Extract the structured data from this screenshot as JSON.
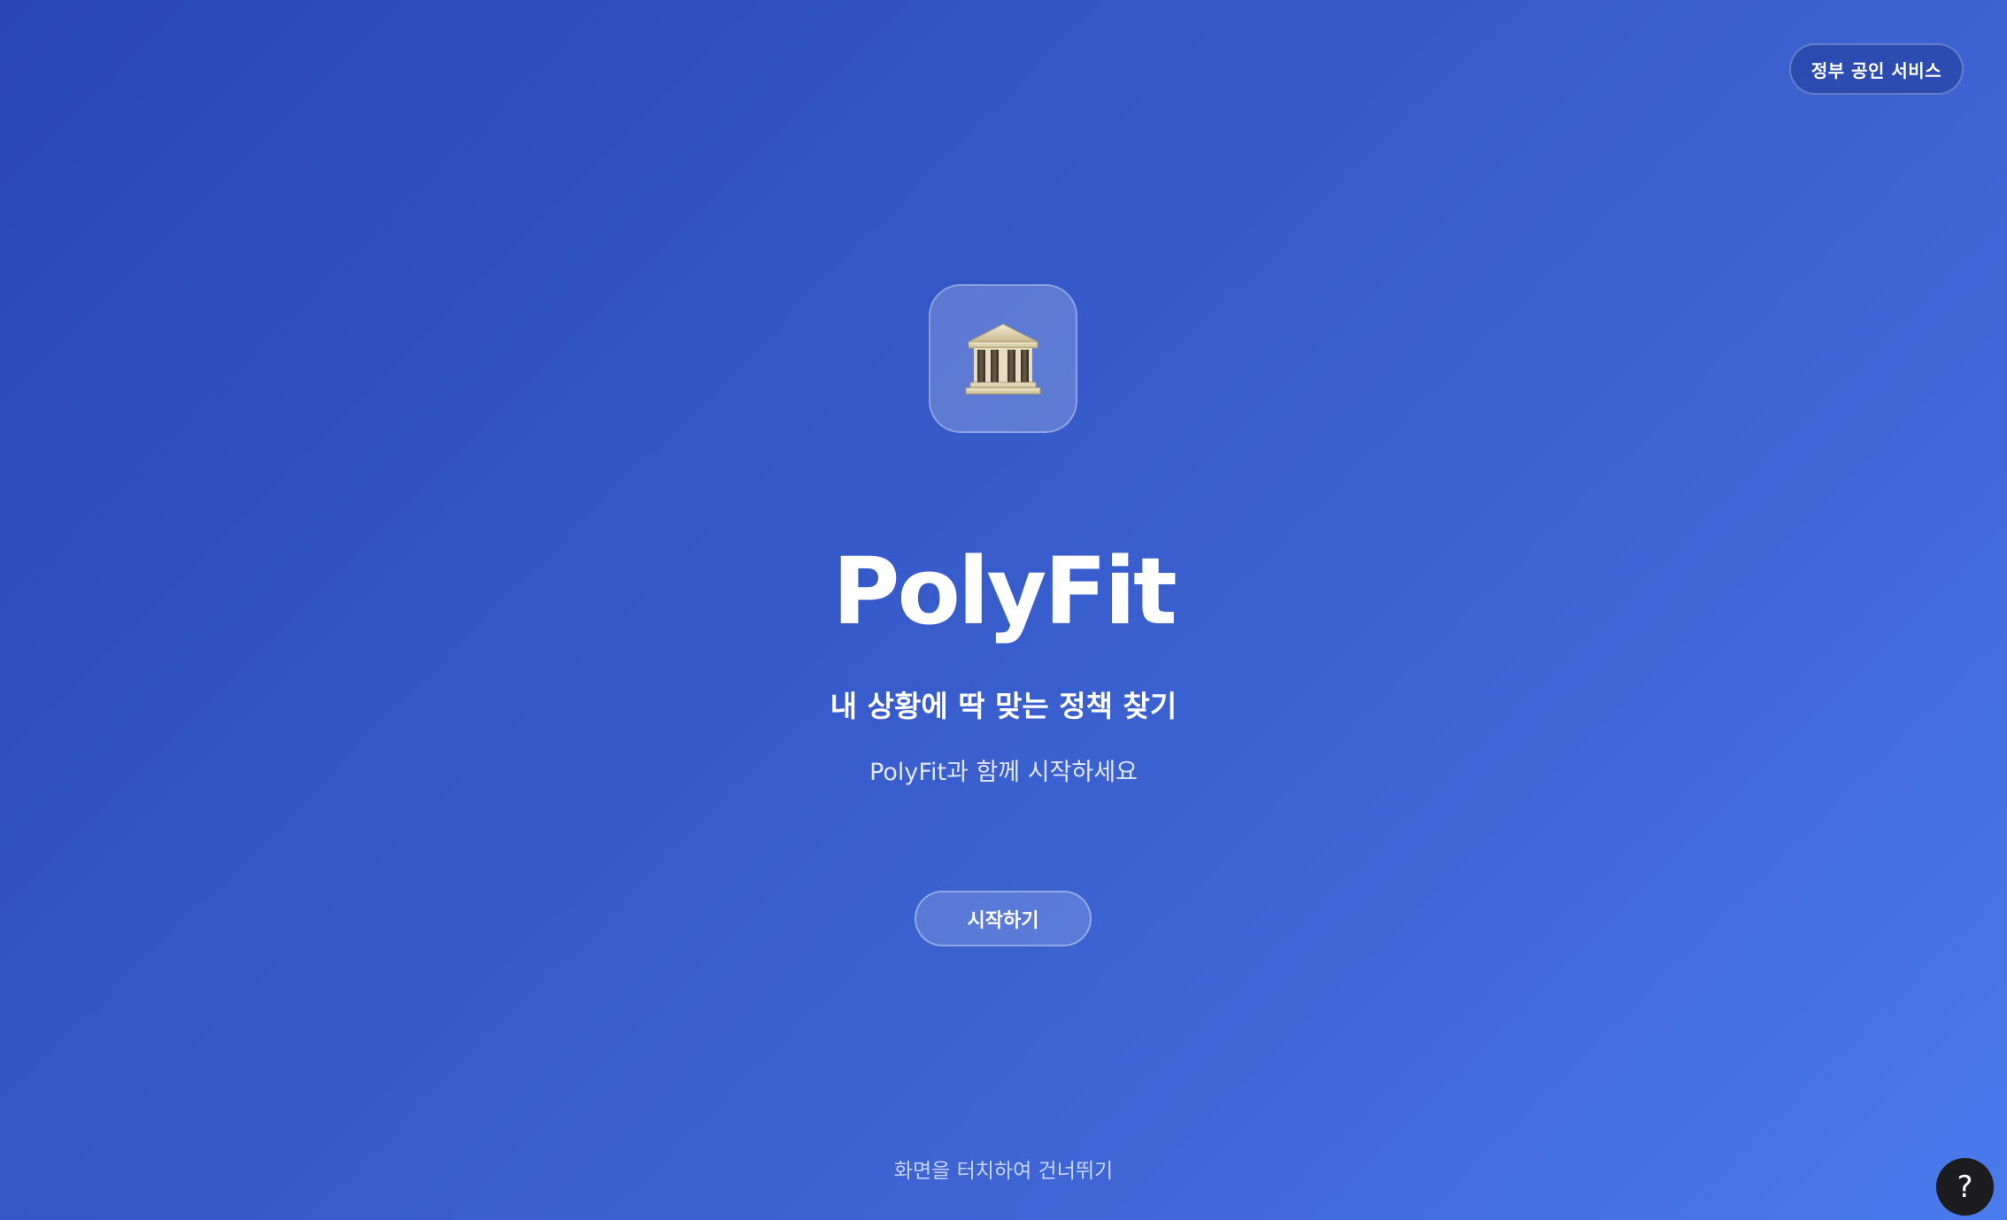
{
  "header": {
    "badge_label": "정부 공인 서비스"
  },
  "hero": {
    "logo_icon": "classical-building-icon",
    "title": "PolyFit",
    "subtitle": "내 상황에 딱 맞는 정책 찾기",
    "description": "PolyFit과 함께 시작하세요",
    "start_button_label": "시작하기"
  },
  "footer": {
    "skip_text": "화면을 터치하여 건너뛰기",
    "help_button_label": "?"
  },
  "colors": {
    "background_start": "#2a46b6",
    "background_end": "#4a7bec",
    "help_button": "#1c1c1e"
  }
}
